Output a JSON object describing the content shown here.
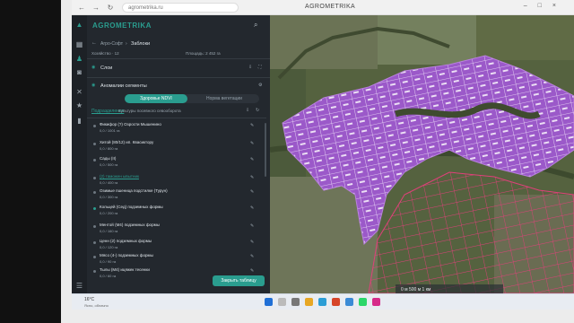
{
  "browser": {
    "url": "agrometrika.ru",
    "window_title": "AGROMETRIKA"
  },
  "app": {
    "name": "AGROMETRIKA"
  },
  "breadcrumb": {
    "parent": "Агро-Софт",
    "separator": "›",
    "current": "Заблоки"
  },
  "subheader": {
    "left": "Хозяйство · 12",
    "right": "Площадь: 2 452 га"
  },
  "layers": {
    "label": "Слои"
  },
  "fields": {
    "label": "Аномалии сегменты"
  },
  "modes": {
    "active": "Здоровье NDVI",
    "inactive": "Норма вегетации"
  },
  "subtabs": {
    "active": "Подразделения",
    "inactive": "Культуры посевного севооборота"
  },
  "crops": [
    {
      "title": "Фикифор (?) Озрости Мышенино",
      "sub": "0,0 / 1001 га"
    },
    {
      "title": "Хитой (80/12) ип. Квасиктору",
      "sub": "0,0 / 800 га"
    },
    {
      "title": "Сады (II)",
      "sub": "0,0 / 500 га"
    },
    {
      "title": "(2) таможен ывытник",
      "sub": "0,0 / 400 га"
    },
    {
      "title": "Озимые пшеница подстилке (Турун)",
      "sub": "0,0 / 300 га"
    },
    {
      "title": "Кольцей (Сед) подземных формы",
      "sub": "0,0 / 200 га"
    },
    {
      "title": "Ментой (М4) подземных формы",
      "sub": "0,0 / 160 га"
    },
    {
      "title": "Ценн (2) подземных формы",
      "sub": "0,0 / 120 га"
    },
    {
      "title": "Мясо (4-) подземных формы",
      "sub": "0,0 / 90 га"
    },
    {
      "title": "Тылы (М4) ицяжек тесенки",
      "sub": "0,0 / 60 га"
    }
  ],
  "submit": {
    "label": "Закрыть таблицу"
  },
  "map": {
    "scale_label": "0 м 500 м   1 км"
  },
  "status": {
    "temp": "16°C",
    "weather": "Ясно, облачно"
  },
  "colors": {
    "accent": "#2a9d8f",
    "field_fill": "#9b59c9",
    "field_outline": "#e0407a",
    "panel_bg": "#23282e"
  }
}
